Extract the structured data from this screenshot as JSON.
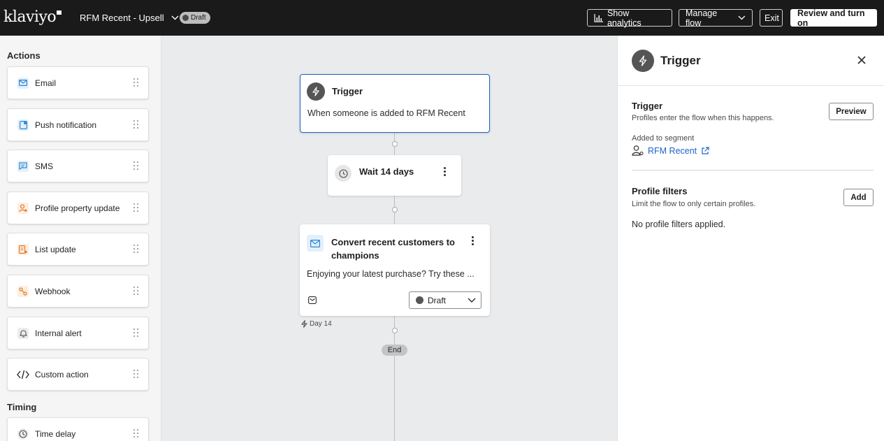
{
  "topbar": {
    "logo": "klaviyo",
    "flow_name": "RFM Recent - Upsell",
    "status_badge": "Draft",
    "show_analytics": "Show analytics",
    "manage_flow": "Manage flow",
    "exit": "Exit",
    "review_turn_on": "Review and turn on"
  },
  "sidebar": {
    "actions_title": "Actions",
    "actions": [
      {
        "label": "Email",
        "icon": "email-icon"
      },
      {
        "label": "Push notification",
        "icon": "push-icon"
      },
      {
        "label": "SMS",
        "icon": "sms-icon"
      },
      {
        "label": "Profile property update",
        "icon": "profile-icon"
      },
      {
        "label": "List update",
        "icon": "list-icon"
      },
      {
        "label": "Webhook",
        "icon": "webhook-icon"
      },
      {
        "label": "Internal alert",
        "icon": "bell-icon"
      },
      {
        "label": "Custom action",
        "icon": "code-icon"
      }
    ],
    "timing_title": "Timing",
    "timing": [
      {
        "label": "Time delay",
        "icon": "clock-icon"
      }
    ]
  },
  "canvas": {
    "trigger": {
      "title": "Trigger",
      "description": "When someone is added to RFM Recent"
    },
    "wait": {
      "title": "Wait 14 days"
    },
    "email": {
      "title_line1": "Convert recent customers to",
      "title_line2": "champions",
      "preview": "Enjoying your latest purchase? Try these ...",
      "status": "Draft"
    },
    "day_label": "Day 14",
    "end_label": "End"
  },
  "panel": {
    "title": "Trigger",
    "trigger_heading": "Trigger",
    "trigger_sub": "Profiles enter the flow when this happens.",
    "preview_button": "Preview",
    "segment_label": "Added to segment",
    "segment_name": "RFM Recent",
    "filters_heading": "Profile filters",
    "filters_sub": "Limit the flow to only certain profiles.",
    "add_button": "Add",
    "no_filters": "No profile filters applied."
  },
  "colors": {
    "topbar_bg": "#1a1a1a",
    "link_blue": "#1c64c8",
    "canvas_bg": "#e9ebed",
    "email_blue": "#2b86d1",
    "orange": "#e07b2a"
  }
}
